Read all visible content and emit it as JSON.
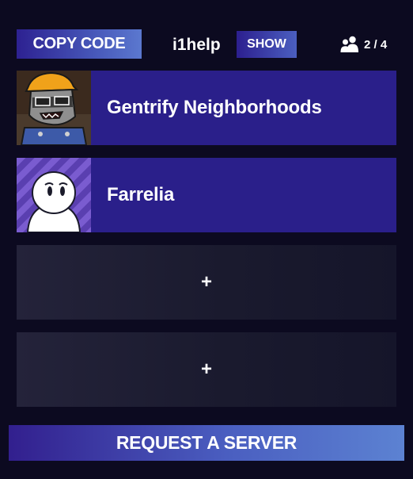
{
  "header": {
    "copy_code_label": "COPY CODE",
    "lobby_code": "i1help",
    "show_label": "SHOW",
    "player_count": "2 / 4",
    "player_count_icon": "users-icon"
  },
  "slots": [
    {
      "type": "player",
      "name": "Gentrify Neighborhoods",
      "avatar": "raccoon-hardhat-avatar"
    },
    {
      "type": "player",
      "name": "Farrelia",
      "avatar": "white-blob-avatar"
    },
    {
      "type": "empty",
      "label": "+"
    },
    {
      "type": "empty",
      "label": "+"
    }
  ],
  "footer": {
    "request_label": "REQUEST A SERVER"
  },
  "colors": {
    "background": "#0c0a20",
    "slot_filled": "#2a1f8a",
    "accent_light": "#5b78cf",
    "accent_dark": "#2d2191"
  }
}
